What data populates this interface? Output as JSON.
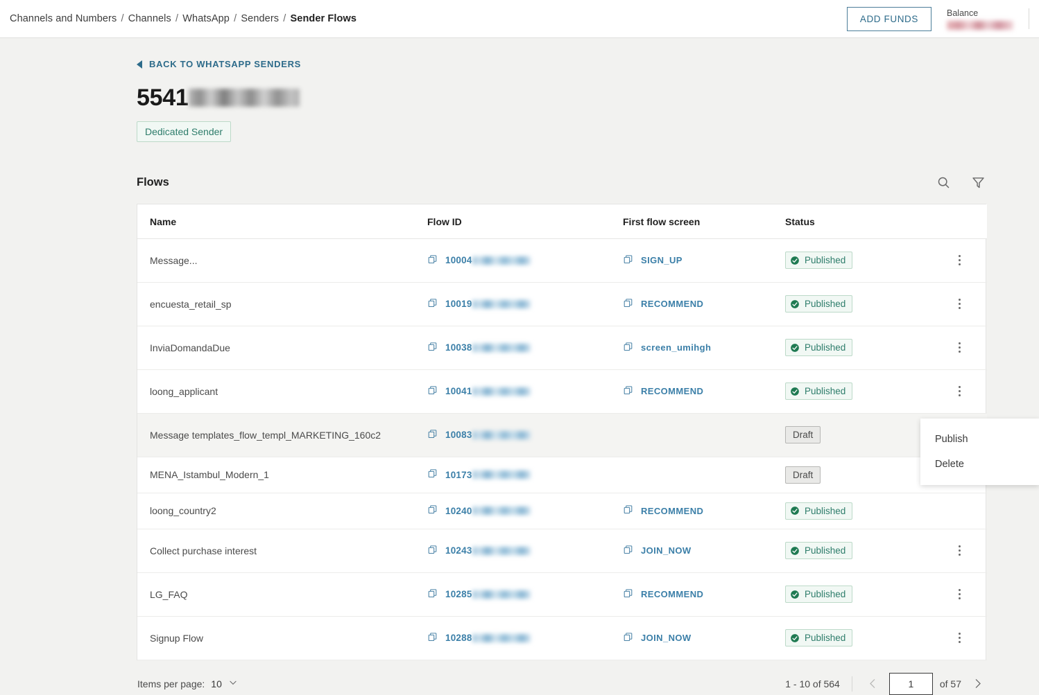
{
  "topbar": {
    "breadcrumb": [
      "Channels and Numbers",
      "Channels",
      "WhatsApp",
      "Senders",
      "Sender Flows"
    ],
    "separator": "/",
    "add_funds_label": "ADD FUNDS",
    "balance_label": "Balance",
    "balance_value": ""
  },
  "page": {
    "back_link": "BACK TO WHATSAPP SENDERS",
    "title_prefix": "5541",
    "title_redacted": "",
    "badge": "Dedicated Sender"
  },
  "flows": {
    "section_title": "Flows",
    "search_icon": "search-icon",
    "filter_icon": "filter-icon",
    "columns": [
      "Name",
      "Flow ID",
      "First flow screen",
      "Status"
    ],
    "rows": [
      {
        "name": "Message...",
        "flow_id": "10004",
        "screen": "SIGN_UP",
        "status": "Published"
      },
      {
        "name": "encuesta_retail_sp",
        "flow_id": "10019",
        "screen": "RECOMMEND",
        "status": "Published"
      },
      {
        "name": "InviaDomandaDue",
        "flow_id": "10038",
        "screen": "screen_umihgh",
        "status": "Published"
      },
      {
        "name": "loong_applicant",
        "flow_id": "10041",
        "screen": "RECOMMEND",
        "status": "Published"
      },
      {
        "name": "Message templates_flow_templ_MARKETING_160c2",
        "flow_id": "10083",
        "screen": "",
        "status": "Draft"
      },
      {
        "name": "MENA_Istambul_Modern_1",
        "flow_id": "10173",
        "screen": "",
        "status": "Draft"
      },
      {
        "name": "loong_country2",
        "flow_id": "10240",
        "screen": "RECOMMEND",
        "status": "Published"
      },
      {
        "name": "Collect purchase interest",
        "flow_id": "10243",
        "screen": "JOIN_NOW",
        "status": "Published"
      },
      {
        "name": "LG_FAQ",
        "flow_id": "10285",
        "screen": "RECOMMEND",
        "status": "Published"
      },
      {
        "name": "Signup Flow",
        "flow_id": "10288",
        "screen": "JOIN_NOW",
        "status": "Published"
      }
    ]
  },
  "context_menu": {
    "items": [
      "Publish",
      "Delete"
    ]
  },
  "pagination": {
    "items_per_page_label": "Items per page:",
    "items_per_page_value": "10",
    "range": "1 - 10 of 564",
    "current_page": "1",
    "total_pages_label": "of 57"
  },
  "colors": {
    "accent_blue": "#2d6b8a",
    "link_blue": "#3b7fa8",
    "success_green": "#2e7d6b",
    "page_bg": "#f2f2f0"
  }
}
